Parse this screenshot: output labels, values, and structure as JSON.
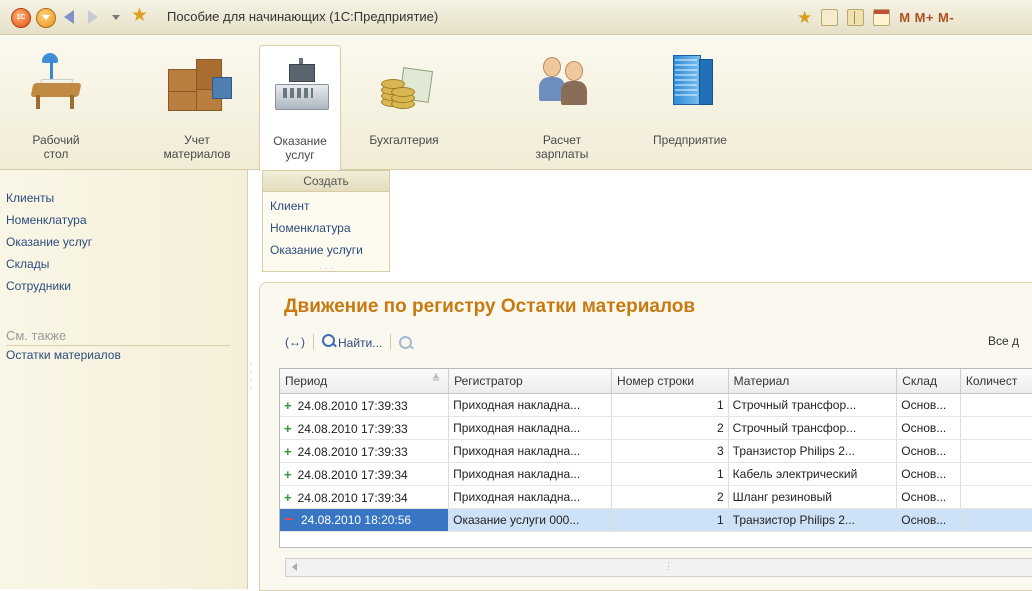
{
  "window": {
    "title": "Пособие для начинающих (1С:Предприятие)",
    "logo_text": "1С",
    "memory_buttons": [
      "M",
      "M+",
      "M-"
    ]
  },
  "sections": [
    {
      "label": "Рабочий\nстол",
      "icon": "desk-icon"
    },
    {
      "label": "Учет\nматериалов",
      "icon": "boxes-icon"
    },
    {
      "label": "Оказание\nуслуг",
      "icon": "cash-register-icon",
      "active": true
    },
    {
      "label": "Бухгалтерия",
      "icon": "coins-icon"
    },
    {
      "label": "Расчет\nзарплаты",
      "icon": "people-icon"
    },
    {
      "label": "Предприятие",
      "icon": "building-icon"
    }
  ],
  "nav": {
    "items": [
      "Клиенты",
      "Номенклатура",
      "Оказание услуг",
      "Склады",
      "Сотрудники"
    ],
    "see_also_title": "См. также",
    "see_also_items": [
      "Остатки материалов"
    ]
  },
  "create_menu": {
    "header": "Создать",
    "items": [
      "Клиент",
      "Номенклатура",
      "Оказание услуги"
    ]
  },
  "document": {
    "title": "Движение по регистру Остатки материалов",
    "toolbar": {
      "toggle_label": "(↔)",
      "find_label": "Найти...",
      "all_label": "Все д"
    },
    "table": {
      "columns": [
        "Период",
        "Регистратор",
        "Номер строки",
        "Материал",
        "Склад",
        "Количест"
      ],
      "rows": [
        {
          "sign": "+",
          "period": "24.08.2010 17:39:33",
          "registrar": "Приходная накладна...",
          "line": "1",
          "material": "Строчный трансфор...",
          "warehouse": "Основ...",
          "qty": ""
        },
        {
          "sign": "+",
          "period": "24.08.2010 17:39:33",
          "registrar": "Приходная накладна...",
          "line": "2",
          "material": "Строчный трансфор...",
          "warehouse": "Основ...",
          "qty": ""
        },
        {
          "sign": "+",
          "period": "24.08.2010 17:39:33",
          "registrar": "Приходная накладна...",
          "line": "3",
          "material": "Транзистор Philips 2...",
          "warehouse": "Основ...",
          "qty": ""
        },
        {
          "sign": "+",
          "period": "24.08.2010 17:39:34",
          "registrar": "Приходная накладна...",
          "line": "1",
          "material": "Кабель электрический",
          "warehouse": "Основ...",
          "qty": ""
        },
        {
          "sign": "+",
          "period": "24.08.2010 17:39:34",
          "registrar": "Приходная накладна...",
          "line": "2",
          "material": "Шланг резиновый",
          "warehouse": "Основ...",
          "qty": ""
        },
        {
          "sign": "-",
          "period": "24.08.2010 18:20:56",
          "registrar": "Оказание услуги 000...",
          "line": "1",
          "material": "Транзистор Philips 2...",
          "warehouse": "Основ...",
          "qty": "",
          "selected": true
        }
      ]
    }
  }
}
